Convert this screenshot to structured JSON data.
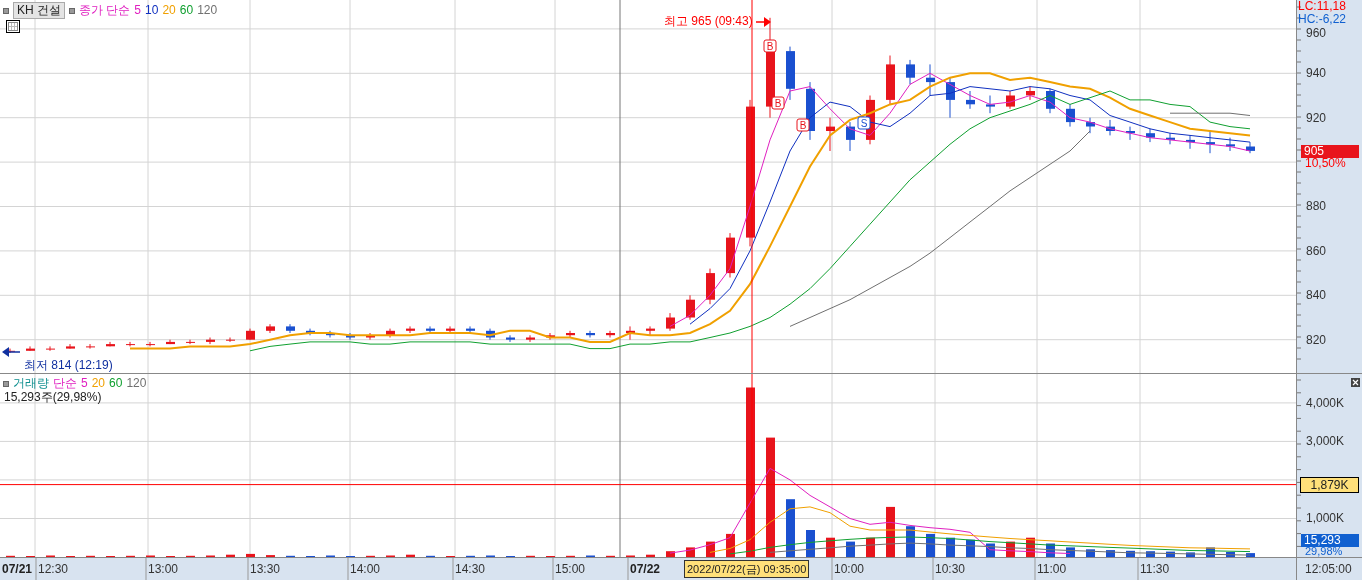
{
  "price_panel": {
    "name": "KH 건설",
    "ma_label": "종가 단순",
    "high_note": "최고 965 (09:43)",
    "low_note": "최저 814 (12:19)",
    "markers": [
      {
        "kind": "buy",
        "text": "B"
      },
      {
        "kind": "buy",
        "text": "B"
      },
      {
        "kind": "buy",
        "text": "B"
      },
      {
        "kind": "sell",
        "text": "S"
      }
    ],
    "chart_data": {
      "type": "candlestick",
      "ylim": [
        805,
        973
      ],
      "yticks": [
        820,
        840,
        860,
        880,
        920,
        940,
        960
      ],
      "grid": true,
      "ohlc": [
        [
          815,
          816,
          814,
          815
        ],
        [
          815,
          817,
          815,
          816
        ],
        [
          816,
          817,
          815,
          816
        ],
        [
          816,
          818,
          816,
          817
        ],
        [
          817,
          818,
          816,
          817
        ],
        [
          817,
          819,
          817,
          818
        ],
        [
          818,
          819,
          817,
          818
        ],
        [
          818,
          819,
          817,
          818
        ],
        [
          818,
          820,
          818,
          819
        ],
        [
          819,
          820,
          818,
          819
        ],
        [
          819,
          821,
          818,
          820
        ],
        [
          820,
          821,
          819,
          820
        ],
        [
          820,
          825,
          820,
          824
        ],
        [
          824,
          827,
          823,
          826
        ],
        [
          826,
          827,
          823,
          824
        ],
        [
          824,
          825,
          822,
          823
        ],
        [
          823,
          824,
          821,
          822
        ],
        [
          822,
          823,
          820,
          821
        ],
        [
          821,
          823,
          820,
          822
        ],
        [
          822,
          825,
          821,
          824
        ],
        [
          824,
          826,
          823,
          825
        ],
        [
          825,
          826,
          823,
          824
        ],
        [
          824,
          826,
          823,
          825
        ],
        [
          825,
          826,
          823,
          824
        ],
        [
          824,
          825,
          820,
          821
        ],
        [
          821,
          822,
          819,
          820
        ],
        [
          820,
          822,
          819,
          821
        ],
        [
          821,
          823,
          820,
          822
        ],
        [
          822,
          824,
          821,
          823
        ],
        [
          823,
          824,
          821,
          822
        ],
        [
          822,
          824,
          821,
          823
        ],
        [
          823,
          826,
          820,
          824
        ],
        [
          824,
          826,
          822,
          825
        ],
        [
          825,
          832,
          824,
          830
        ],
        [
          830,
          840,
          829,
          838
        ],
        [
          838,
          852,
          836,
          850
        ],
        [
          850,
          868,
          848,
          866
        ],
        [
          866,
          928,
          862,
          925
        ],
        [
          925,
          965,
          920,
          950
        ],
        [
          950,
          952,
          928,
          933
        ],
        [
          933,
          936,
          910,
          914
        ],
        [
          914,
          920,
          905,
          916
        ],
        [
          916,
          918,
          905,
          910
        ],
        [
          910,
          930,
          908,
          928
        ],
        [
          928,
          948,
          926,
          944
        ],
        [
          944,
          946,
          935,
          938
        ],
        [
          938,
          944,
          930,
          936
        ],
        [
          936,
          938,
          920,
          928
        ],
        [
          928,
          932,
          924,
          926
        ],
        [
          926,
          930,
          922,
          925
        ],
        [
          925,
          932,
          924,
          930
        ],
        [
          930,
          934,
          928,
          932
        ],
        [
          932,
          933,
          922,
          924
        ],
        [
          924,
          926,
          916,
          918
        ],
        [
          918,
          920,
          913,
          916
        ],
        [
          916,
          919,
          912,
          914
        ],
        [
          914,
          916,
          910,
          913
        ],
        [
          913,
          915,
          909,
          911
        ],
        [
          911,
          913,
          908,
          910
        ],
        [
          910,
          912,
          906,
          909
        ],
        [
          909,
          914,
          904,
          908
        ],
        [
          908,
          911,
          905,
          907
        ],
        [
          907,
          909,
          904,
          905
        ]
      ],
      "series": [
        {
          "name": "5",
          "color": "#e020c0",
          "values": [
            null,
            null,
            null,
            null,
            null,
            null,
            null,
            null,
            null,
            null,
            null,
            null,
            null,
            null,
            null,
            null,
            null,
            null,
            null,
            null,
            null,
            null,
            null,
            null,
            null,
            null,
            null,
            null,
            null,
            null,
            null,
            null,
            null,
            826,
            831,
            840,
            852,
            880,
            910,
            932,
            934,
            924,
            915,
            912,
            922,
            935,
            940,
            935,
            930,
            926,
            927,
            930,
            927,
            920,
            918,
            915,
            913,
            911,
            910,
            909,
            908,
            907,
            905
          ],
          "type": "line"
        },
        {
          "name": "10",
          "color": "#1030c0",
          "values": [
            null,
            null,
            null,
            null,
            null,
            null,
            null,
            null,
            null,
            null,
            null,
            null,
            null,
            null,
            null,
            null,
            null,
            null,
            null,
            null,
            null,
            null,
            null,
            null,
            null,
            null,
            null,
            null,
            null,
            null,
            null,
            null,
            null,
            null,
            827,
            834,
            843,
            860,
            882,
            905,
            920,
            927,
            925,
            918,
            916,
            922,
            930,
            931,
            934,
            933,
            932,
            934,
            933,
            930,
            928,
            921,
            918,
            915,
            913,
            912,
            911,
            910,
            909
          ],
          "type": "line"
        },
        {
          "name": "20",
          "color": "#f0a000",
          "values": [
            null,
            null,
            null,
            null,
            null,
            null,
            816,
            816,
            816,
            817,
            817,
            817,
            818,
            820,
            822,
            823,
            823,
            822,
            822,
            822,
            822,
            823,
            823,
            823,
            822,
            824,
            824,
            821,
            821,
            819,
            819,
            823,
            822,
            822,
            823,
            827,
            833,
            845,
            862,
            880,
            898,
            912,
            919,
            922,
            926,
            928,
            934,
            938,
            940,
            940,
            937,
            938,
            936,
            934,
            933,
            929,
            924,
            921,
            918,
            915,
            914,
            913,
            912
          ],
          "type": "line"
        },
        {
          "name": "60",
          "color": "#10a030",
          "values": [
            null,
            null,
            null,
            null,
            null,
            null,
            null,
            null,
            null,
            null,
            null,
            null,
            815,
            817,
            818,
            819,
            819,
            819,
            818,
            818,
            819,
            819,
            819,
            819,
            818,
            818,
            818,
            818,
            818,
            816,
            816,
            818,
            818,
            819,
            819,
            821,
            823,
            826,
            830,
            836,
            843,
            852,
            862,
            872,
            882,
            892,
            900,
            908,
            915,
            920,
            923,
            926,
            930,
            926,
            929,
            932,
            928,
            928,
            926,
            925,
            918,
            916,
            915
          ],
          "type": "line"
        },
        {
          "name": "120",
          "color": "#707070",
          "values": [
            null,
            null,
            null,
            null,
            null,
            null,
            null,
            null,
            null,
            null,
            null,
            null,
            null,
            null,
            null,
            null,
            null,
            null,
            null,
            null,
            null,
            null,
            null,
            null,
            null,
            null,
            null,
            null,
            null,
            null,
            null,
            null,
            null,
            null,
            null,
            null,
            null,
            null,
            null,
            826,
            830,
            834,
            838,
            843,
            848,
            853,
            859,
            866,
            873,
            880,
            887,
            893,
            899,
            905,
            914,
            null,
            null,
            null,
            922,
            922,
            922,
            922,
            921
          ],
          "type": "line"
        }
      ]
    },
    "axis": {
      "lc": "LC:11,18",
      "hc": "HC:-6,22",
      "current_price": "905",
      "change": "10,50%"
    }
  },
  "volume_panel": {
    "name": "거래량",
    "ma_label": "단순",
    "reading": "15,293주(29,98%)",
    "chart_data": {
      "type": "bar",
      "ylim": [
        0,
        4750
      ],
      "yticks": [
        {
          "value": 4000,
          "label": "4,000K"
        },
        {
          "value": 3000,
          "label": "3,000K"
        },
        {
          "value": 1000,
          "label": "1,000K"
        }
      ],
      "grid": true,
      "ref_lines": [
        {
          "axis": "y",
          "value": 1879,
          "label": "1,879K"
        }
      ],
      "values": [
        30,
        20,
        40,
        20,
        30,
        20,
        30,
        40,
        20,
        30,
        40,
        60,
        80,
        50,
        30,
        20,
        40,
        20,
        30,
        40,
        60,
        30,
        20,
        30,
        40,
        20,
        30,
        20,
        30,
        40,
        30,
        40,
        60,
        150,
        250,
        400,
        600,
        4400,
        3100,
        1500,
        700,
        500,
        400,
        500,
        1300,
        800,
        600,
        500,
        450,
        350,
        400,
        500,
        350,
        250,
        200,
        180,
        160,
        150,
        140,
        120,
        250,
        130,
        100
      ],
      "colors": [
        "#e8141c",
        "#e8141c",
        "#e8141c",
        "#e8141c",
        "#e8141c",
        "#e8141c",
        "#e8141c",
        "#e8141c",
        "#e8141c",
        "#e8141c",
        "#e8141c",
        "#e8141c",
        "#e8141c",
        "#e8141c",
        "#1a50d0",
        "#1a50d0",
        "#1a50d0",
        "#1a50d0",
        "#e8141c",
        "#e8141c",
        "#e8141c",
        "#1a50d0",
        "#e8141c",
        "#1a50d0",
        "#1a50d0",
        "#1a50d0",
        "#e8141c",
        "#e8141c",
        "#e8141c",
        "#1a50d0",
        "#e8141c",
        "#e8141c",
        "#e8141c",
        "#e8141c",
        "#e8141c",
        "#e8141c",
        "#e8141c",
        "#e8141c",
        "#e8141c",
        "#1a50d0",
        "#1a50d0",
        "#e8141c",
        "#1a50d0",
        "#e8141c",
        "#e8141c",
        "#1a50d0",
        "#1a50d0",
        "#1a50d0",
        "#1a50d0",
        "#1a50d0",
        "#e8141c",
        "#e8141c",
        "#1a50d0",
        "#1a50d0",
        "#1a50d0",
        "#1a50d0",
        "#1a50d0",
        "#1a50d0",
        "#1a50d0",
        "#1a50d0",
        "#1a50d0",
        "#1a50d0",
        "#1a50d0"
      ],
      "series": [
        {
          "name": "5",
          "color": "#e020c0",
          "values": [
            null,
            null,
            null,
            null,
            null,
            null,
            null,
            null,
            null,
            null,
            null,
            null,
            null,
            null,
            null,
            null,
            null,
            null,
            null,
            null,
            null,
            null,
            null,
            null,
            null,
            null,
            null,
            null,
            null,
            null,
            null,
            null,
            null,
            100,
            180,
            320,
            500,
            1400,
            2300,
            2000,
            1600,
            1300,
            1000,
            850,
            900,
            820,
            760,
            720,
            640,
            190,
            160,
            140,
            110,
            90,
            null,
            null,
            null,
            null,
            null,
            null,
            null,
            null,
            null
          ],
          "type": "line"
        },
        {
          "name": "20",
          "color": "#f0a000",
          "values": [
            null,
            null,
            null,
            null,
            null,
            null,
            null,
            null,
            null,
            null,
            null,
            null,
            null,
            null,
            null,
            null,
            null,
            null,
            null,
            null,
            null,
            null,
            null,
            null,
            null,
            null,
            null,
            null,
            null,
            null,
            null,
            null,
            null,
            null,
            null,
            120,
            220,
            450,
            900,
            1250,
            1300,
            1150,
            800,
            700,
            700,
            700,
            650,
            600,
            560,
            520,
            480,
            450,
            420,
            390,
            360,
            330,
            300,
            280,
            260,
            240,
            230,
            220,
            210
          ],
          "type": "line"
        },
        {
          "name": "60",
          "color": "#10a030",
          "values": [
            null,
            null,
            null,
            null,
            null,
            null,
            null,
            null,
            null,
            null,
            null,
            null,
            null,
            null,
            null,
            null,
            null,
            null,
            null,
            null,
            null,
            null,
            null,
            null,
            null,
            null,
            null,
            null,
            null,
            null,
            null,
            null,
            null,
            null,
            null,
            null,
            80,
            150,
            250,
            320,
            380,
            420,
            460,
            490,
            510,
            520,
            500,
            480,
            440,
            400,
            370,
            340,
            310,
            290,
            270,
            250,
            230,
            210,
            190,
            170,
            160,
            150,
            140
          ],
          "type": "line"
        },
        {
          "name": "120",
          "color": "#707070",
          "values": [
            null,
            null,
            null,
            null,
            null,
            null,
            null,
            null,
            null,
            null,
            null,
            null,
            null,
            null,
            null,
            null,
            null,
            null,
            null,
            null,
            null,
            null,
            null,
            null,
            null,
            null,
            null,
            null,
            null,
            null,
            null,
            null,
            null,
            null,
            null,
            null,
            null,
            null,
            120,
            160,
            200,
            240,
            280,
            310,
            340,
            360,
            340,
            310,
            290,
            270,
            240,
            220,
            190,
            170,
            150,
            130,
            110,
            100,
            90,
            80,
            70,
            60,
            50
          ],
          "type": "line"
        }
      ]
    },
    "axis": {
      "current_volume": "15,293",
      "ratio": "29,98%"
    }
  },
  "time_axis": {
    "labels": [
      {
        "text": "07/21",
        "kind": "date"
      },
      {
        "text": "12:30",
        "kind": "time"
      },
      {
        "text": "13:00",
        "kind": "time"
      },
      {
        "text": "13:30",
        "kind": "time"
      },
      {
        "text": "14:00",
        "kind": "time"
      },
      {
        "text": "14:30",
        "kind": "time"
      },
      {
        "text": "15:00",
        "kind": "time"
      },
      {
        "text": "07/22",
        "kind": "date"
      },
      {
        "text": "10:00",
        "kind": "time"
      },
      {
        "text": "10:30",
        "kind": "time"
      },
      {
        "text": "11:00",
        "kind": "time"
      },
      {
        "text": "11:30",
        "kind": "time"
      }
    ],
    "crosshair_time": "2022/07/22(금) 09:35:00",
    "end_time": "12:05:00"
  }
}
